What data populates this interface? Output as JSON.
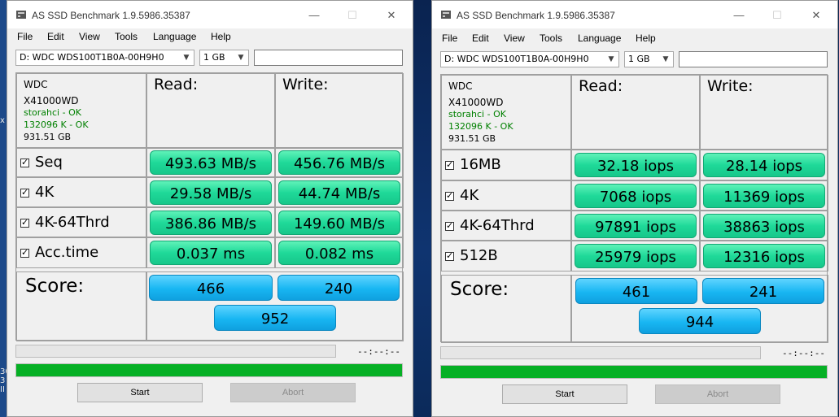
{
  "desktop": {
    "glyphs": [
      "x",
      "30",
      "3",
      "II"
    ]
  },
  "windows": [
    {
      "title": "AS SSD Benchmark 1.9.5986.35387",
      "menu": [
        "File",
        "Edit",
        "View",
        "Tools",
        "Language",
        "Help"
      ],
      "drive_select": "D: WDC WDS100T1B0A-00H9H0",
      "size_select": "1 GB",
      "info": {
        "vendor": "WDC",
        "model": "X41000WD",
        "driver": "storahci - OK",
        "alignment": "132096 K - OK",
        "capacity": "931.51 GB"
      },
      "headers": {
        "read": "Read:",
        "write": "Write:"
      },
      "rows": [
        {
          "label": "Seq",
          "read": "493.63 MB/s",
          "write": "456.76 MB/s"
        },
        {
          "label": "4K",
          "read": "29.58 MB/s",
          "write": "44.74 MB/s"
        },
        {
          "label": "4K-64Thrd",
          "read": "386.86 MB/s",
          "write": "149.60 MB/s"
        },
        {
          "label": "Acc.time",
          "read": "0.037 ms",
          "write": "0.082 ms"
        }
      ],
      "score": {
        "label": "Score:",
        "read": "466",
        "write": "240",
        "total": "952"
      },
      "time": "--:--:--",
      "progress_fill": 1.0,
      "buttons": {
        "start": "Start",
        "abort": "Abort"
      }
    },
    {
      "title": "AS SSD Benchmark 1.9.5986.35387",
      "menu": [
        "File",
        "Edit",
        "View",
        "Tools",
        "Language",
        "Help"
      ],
      "drive_select": "D: WDC WDS100T1B0A-00H9H0",
      "size_select": "1 GB",
      "info": {
        "vendor": "WDC",
        "model": "X41000WD",
        "driver": "storahci - OK",
        "alignment": "132096 K - OK",
        "capacity": "931.51 GB"
      },
      "headers": {
        "read": "Read:",
        "write": "Write:"
      },
      "rows": [
        {
          "label": "16MB",
          "read": "32.18 iops",
          "write": "28.14 iops"
        },
        {
          "label": "4K",
          "read": "7068 iops",
          "write": "11369 iops"
        },
        {
          "label": "4K-64Thrd",
          "read": "97891 iops",
          "write": "38863 iops"
        },
        {
          "label": "512B",
          "read": "25979 iops",
          "write": "12316 iops"
        }
      ],
      "score": {
        "label": "Score:",
        "read": "461",
        "write": "241",
        "total": "944"
      },
      "time": "--:--:--",
      "progress_fill": 1.0,
      "buttons": {
        "start": "Start",
        "abort": "Abort"
      }
    }
  ],
  "colors": {
    "value_green": "#1fd999",
    "score_blue": "#18b6f2",
    "progress_green": "#06b025",
    "status_ok": "#008000"
  }
}
